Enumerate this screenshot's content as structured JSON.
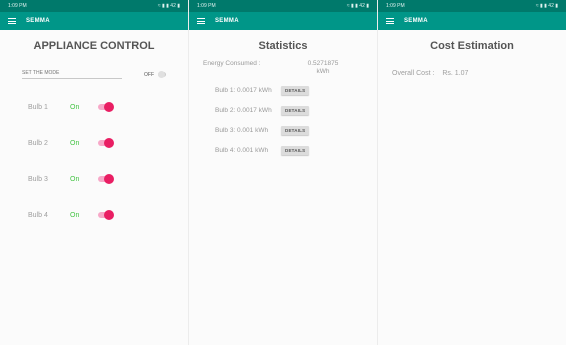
{
  "status_bar": {
    "left": "1:09 PM",
    "right": "≈ ▮ ▮ 42 ▮"
  },
  "appbar": {
    "title": "SEMMA"
  },
  "appliance_control": {
    "title": "APPLIANCE CONTROL",
    "mode_placeholder": "SET THE MODE",
    "mode_toggle_label": "OFF",
    "bulbs": [
      {
        "label": "Bulb 1",
        "state": "On"
      },
      {
        "label": "Bulb 2",
        "state": "On"
      },
      {
        "label": "Bulb 3",
        "state": "On"
      },
      {
        "label": "Bulb 4",
        "state": "On"
      }
    ]
  },
  "statistics": {
    "title": "Statistics",
    "energy_label": "Energy Consumed :",
    "energy_value": "0.5271875",
    "energy_unit": "kWh",
    "rows": [
      {
        "label": "Bulb 1:",
        "value": "0.0017 kWh",
        "button": "DETAILS"
      },
      {
        "label": "Bulb 2:",
        "value": "0.0017 kWh",
        "button": "DETAILS"
      },
      {
        "label": "Bulb 3:",
        "value": "0.001 kWh",
        "button": "DETAILS"
      },
      {
        "label": "Bulb 4:",
        "value": "0.001 kWh",
        "button": "DETAILS"
      }
    ]
  },
  "cost_estimation": {
    "title": "Cost Estimation",
    "overall_label": "Overall Cost :",
    "overall_value": "Rs. 1.07"
  }
}
